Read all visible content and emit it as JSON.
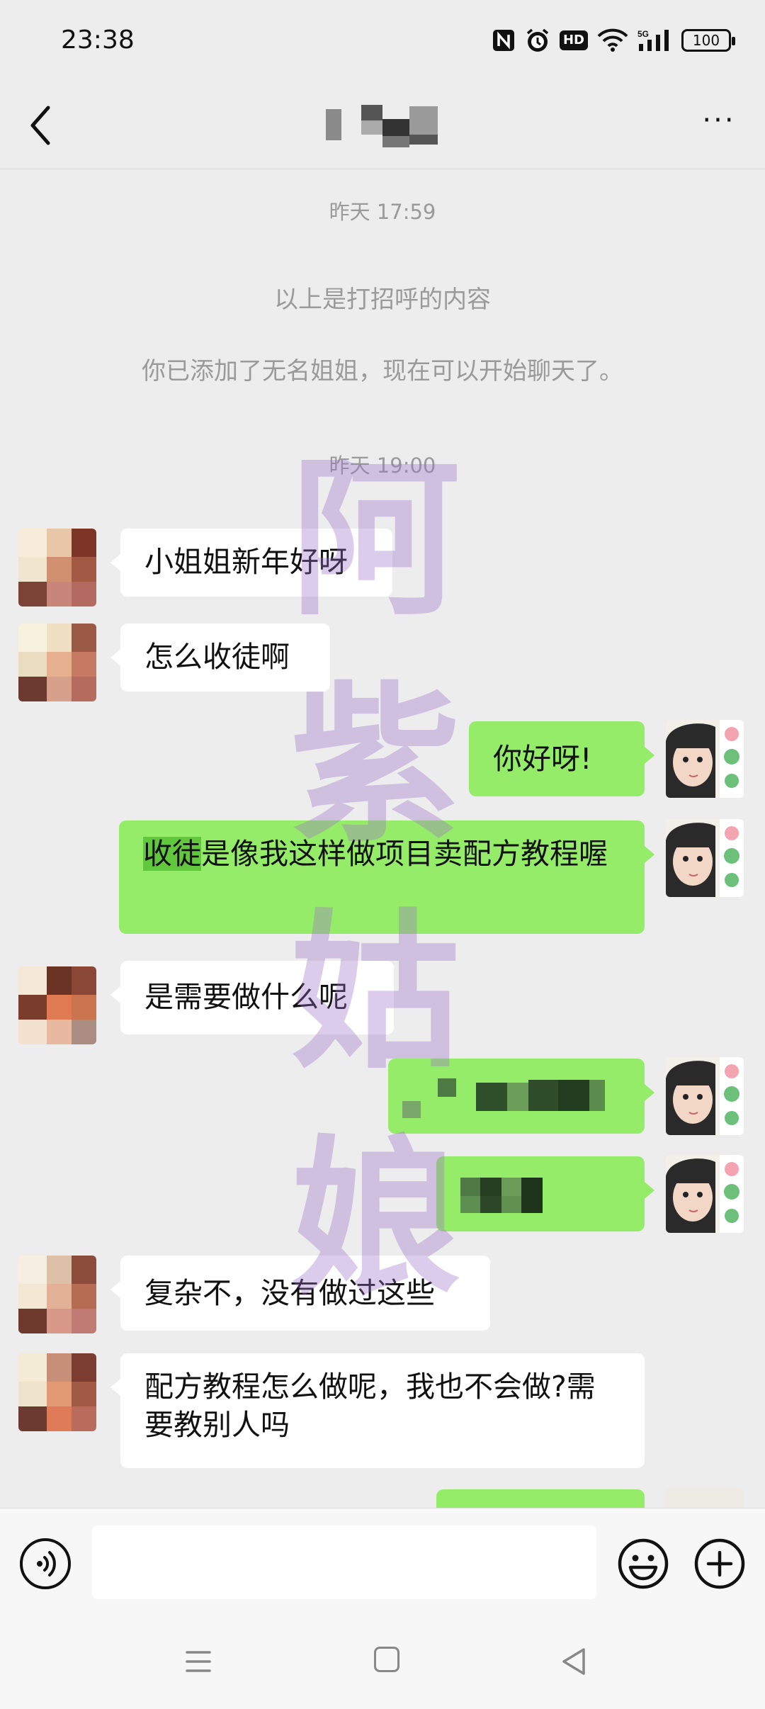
{
  "status_bar": {
    "time": "23:38",
    "network": "5G",
    "hd_label": "HD",
    "battery": "100",
    "icons": [
      "nfc-icon",
      "alarm-icon",
      "hd-icon",
      "wifi-icon",
      "signal-icon",
      "battery-icon"
    ]
  },
  "header": {
    "back_icon": "chevron-left-icon",
    "title": "",
    "more_icon": "more-icon",
    "more_label": "···"
  },
  "messages": {
    "timestamp_1": "昨天 17:59",
    "greeting_note": "以上是打招呼的内容",
    "added_note": "你已添加了无名姐姐，现在可以开始聊天了。",
    "timestamp_2": "昨天 19:00",
    "m1": "小姐姐新年好呀",
    "m2": "怎么收徒啊",
    "m3": "你好呀!",
    "m4_highlight": "收徒",
    "m4_rest": "是像我这样做项目卖配方教程喔",
    "m5": "是需要做什么呢",
    "m8": "复杂不，没有做过这些",
    "m9": "配方教程怎么做呢，我也不会做?需要教别人吗"
  },
  "watermark": {
    "text": "阿紫姑娘"
  },
  "input_bar": {
    "voice_icon": "voice-icon",
    "input_value": "",
    "emoji_icon": "emoji-icon",
    "plus_icon": "plus-icon"
  },
  "nav_bar": {
    "icons": [
      "menu-icon",
      "home-icon",
      "back-icon"
    ]
  },
  "colors": {
    "background": "#ededed",
    "outgoing_bubble": "#95ec69",
    "incoming_bubble": "#ffffff",
    "system_text": "#9a9a9a",
    "watermark": "#9b6fc9"
  }
}
